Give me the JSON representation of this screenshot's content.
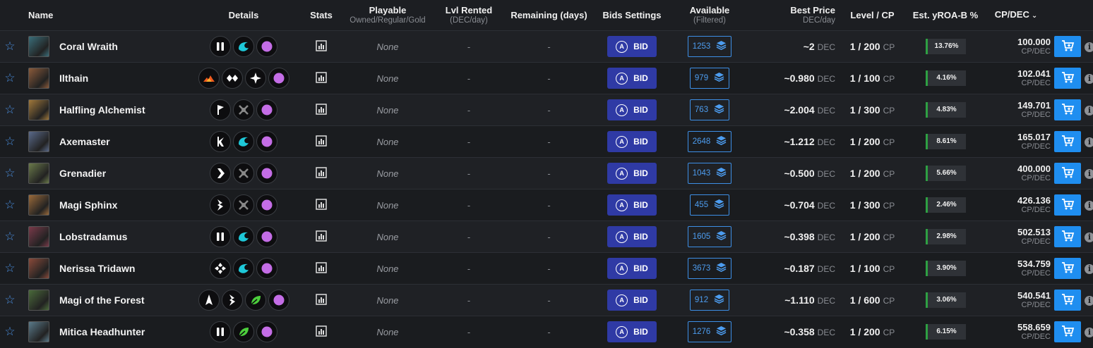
{
  "headers": {
    "name": "Name",
    "details": "Details",
    "stats": "Stats",
    "playable": "Playable",
    "playable_sub": "Owned/Regular/Gold",
    "lvl_rented": "Lvl Rented",
    "lvl_rented_sub": "(DEC/day)",
    "remaining": "Remaining (days)",
    "bids": "Bids Settings",
    "available": "Available",
    "available_sub": "(Filtered)",
    "best_price": "Best Price",
    "best_price_sub": "DEC/day",
    "level": "Level / CP",
    "yroa": "Est. yROA-B %",
    "cpdec": "CP/DEC"
  },
  "labels": {
    "bid": "BID",
    "bid_icon": "A",
    "dec_unit": "DEC",
    "cp_unit": "CP",
    "cpdec_unit": "CP/DEC",
    "info": "i",
    "sort_arrow": "⌄"
  },
  "colors": {
    "bid_button": "#2f3aa5",
    "available_border": "#3d8fe6",
    "cart_button": "#1f8ef0",
    "yroa_bar": "#2ea043",
    "star": "#4a8fe0"
  },
  "rows": [
    {
      "name": "Coral Wraith",
      "icons": [
        "pause-icon",
        "water-icon",
        "gold-foil-icon"
      ],
      "playable": "None",
      "lvl_rented": "-",
      "remaining": "-",
      "available": "1253",
      "price": "~2",
      "level": "1 / 200",
      "yroa": "13.76%",
      "cpdec": "100.000",
      "thumb": "#3a6e7a"
    },
    {
      "name": "Ilthain",
      "icons": [
        "fire-icon",
        "diamond-icon",
        "compass-icon",
        "gold-foil-icon"
      ],
      "playable": "None",
      "lvl_rented": "-",
      "remaining": "-",
      "available": "979",
      "price": "~0.980",
      "level": "1 / 100",
      "yroa": "4.16%",
      "cpdec": "102.041",
      "thumb": "#8a5a3a"
    },
    {
      "name": "Halfling Alchemist",
      "icons": [
        "flag-icon",
        "crossed-swords-icon",
        "gold-foil-icon"
      ],
      "playable": "None",
      "lvl_rented": "-",
      "remaining": "-",
      "available": "763",
      "price": "~2.004",
      "level": "1 / 300",
      "yroa": "4.83%",
      "cpdec": "149.701",
      "thumb": "#a0783a"
    },
    {
      "name": "Axemaster",
      "icons": [
        "axe-icon",
        "water-icon",
        "gold-foil-icon"
      ],
      "playable": "None",
      "lvl_rented": "-",
      "remaining": "-",
      "available": "2648",
      "price": "~1.212",
      "level": "1 / 200",
      "yroa": "8.61%",
      "cpdec": "165.017",
      "thumb": "#5a6a8a"
    },
    {
      "name": "Grenadier",
      "icons": [
        "chevron-icon",
        "crossed-swords-icon",
        "gold-foil-icon"
      ],
      "playable": "None",
      "lvl_rented": "-",
      "remaining": "-",
      "available": "1043",
      "price": "~0.500",
      "level": "1 / 200",
      "yroa": "5.66%",
      "cpdec": "400.000",
      "thumb": "#6a7a4a"
    },
    {
      "name": "Magi Sphinx",
      "icons": [
        "bolt-icon",
        "crossed-swords-icon",
        "gold-foil-icon"
      ],
      "playable": "None",
      "lvl_rented": "-",
      "remaining": "-",
      "available": "455",
      "price": "~0.704",
      "level": "1 / 300",
      "yroa": "2.46%",
      "cpdec": "426.136",
      "thumb": "#9a6a3a"
    },
    {
      "name": "Lobstradamus",
      "icons": [
        "pause-icon",
        "water-icon",
        "gold-foil-icon"
      ],
      "playable": "None",
      "lvl_rented": "-",
      "remaining": "-",
      "available": "1605",
      "price": "~0.398",
      "level": "1 / 200",
      "yroa": "2.98%",
      "cpdec": "502.513",
      "thumb": "#7a3a4a"
    },
    {
      "name": "Nerissa Tridawn",
      "icons": [
        "cross-diamond-icon",
        "water-icon",
        "gold-foil-icon"
      ],
      "playable": "None",
      "lvl_rented": "-",
      "remaining": "-",
      "available": "3673",
      "price": "~0.187",
      "level": "1 / 100",
      "yroa": "3.90%",
      "cpdec": "534.759",
      "thumb": "#8a4a3a"
    },
    {
      "name": "Magi of the Forest",
      "icons": [
        "arrow-up-icon",
        "bolt-icon",
        "earth-leaf-icon",
        "gold-foil-icon"
      ],
      "playable": "None",
      "lvl_rented": "-",
      "remaining": "-",
      "available": "912",
      "price": "~1.110",
      "level": "1 / 600",
      "yroa": "3.06%",
      "cpdec": "540.541",
      "thumb": "#4a6a3a"
    },
    {
      "name": "Mitica Headhunter",
      "icons": [
        "pause-icon",
        "earth-leaf-icon",
        "gold-foil-icon"
      ],
      "playable": "None",
      "lvl_rented": "-",
      "remaining": "-",
      "available": "1276",
      "price": "~0.358",
      "level": "1 / 200",
      "yroa": "6.15%",
      "cpdec": "558.659",
      "thumb": "#5a7a8a"
    }
  ]
}
